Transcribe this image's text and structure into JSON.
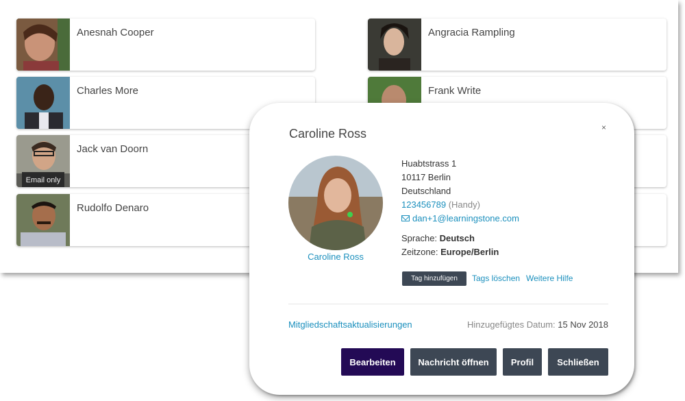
{
  "contacts": [
    {
      "name": "Anesnah Cooper",
      "badge": ""
    },
    {
      "name": "Angracia Rampling",
      "badge": ""
    },
    {
      "name": "Charles More",
      "badge": ""
    },
    {
      "name": "Frank Write",
      "badge": ""
    },
    {
      "name": "Jack van Doorn",
      "badge": "Email only"
    },
    {
      "name": "Rudolfo Denaro",
      "badge": ""
    }
  ],
  "modal": {
    "title": "Caroline Ross",
    "close_label": "×",
    "photo_name": "Caroline Ross",
    "address": {
      "street": "Huabtstrass 1",
      "city": "10117 Berlin",
      "country": "Deutschland"
    },
    "phone": "123456789",
    "phone_type": "(Handy)",
    "email": "dan+1@learningstone.com",
    "language_label": "Sprache:",
    "language": "Deutsch",
    "timezone_label": "Zeitzone:",
    "timezone": "Europe/Berlin",
    "tag_add": "Tag hinzufügen",
    "tag_delete": "Tags löschen",
    "more_help": "Weitere Hilfe",
    "membership_link": "Mitgliedschaftsaktualisierungen",
    "date_label": "Hinzugefügtes Datum:",
    "date_value": "15 Nov 2018",
    "buttons": {
      "edit": "Bearbeiten",
      "open_message": "Nachricht öffnen",
      "profile": "Profil",
      "close": "Schließen"
    }
  },
  "colors": {
    "link": "#1a8fbd",
    "primary_button": "#230a55",
    "dark_button": "#3d4754"
  }
}
